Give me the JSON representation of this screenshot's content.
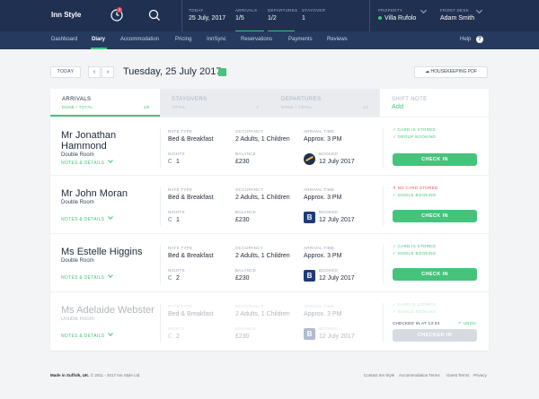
{
  "app": {
    "logo": "Inn Style",
    "notification_count": "3"
  },
  "header": {
    "stats": [
      {
        "label": "TODAY",
        "value": "25 July, 2017"
      },
      {
        "label": "ARRIVALS",
        "value": "1/5"
      },
      {
        "label": "DEPARTURES",
        "value": "1/2"
      },
      {
        "label": "STAYOVER",
        "value": "1"
      }
    ],
    "property_label": "PROPERTY",
    "property_value": "Villa Rufolo",
    "desk_label": "FRONT DESK",
    "desk_value": "Adam Smith"
  },
  "nav": {
    "items": [
      "Dashboard",
      "Diary",
      "Accommodation",
      "Pricing",
      "InnSync",
      "Reservations",
      "Payments",
      "Reviews"
    ],
    "active": "Diary",
    "help": "Help"
  },
  "datebar": {
    "today": "TODAY",
    "prev": "‹",
    "next": "›",
    "date": "Tuesday, 25 July 2017",
    "housekeeping": "HOUSEKEEPING PDF"
  },
  "tabs": [
    {
      "title": "ARRIVALS",
      "sub": "DONE / TOTAL",
      "count": "1/5"
    },
    {
      "title": "STAYOVERS",
      "sub": "TOTAL",
      "count": "1"
    },
    {
      "title": "DEPARTURES",
      "sub": "DONE / TOTAL",
      "count": "1/2"
    },
    {
      "title": "SHIFT NOTE",
      "sub": "Add",
      "count": ""
    }
  ],
  "field_labels": {
    "rate": "RATE TYPE",
    "occupancy": "OCCUPANCY",
    "arrival": "ARRIVAL TIME",
    "nights": "NIGHTS",
    "balance": "BALANCE",
    "booked": "BOOKED",
    "notes": "NOTES & DETAILS"
  },
  "rows": [
    {
      "name": "Mr Jonathan Hammond",
      "room": "Double Room",
      "rate": "Bed & Breakfast",
      "occupancy": "2 Adults, 1 Children",
      "arrival": "Approx. 3 PM",
      "nights": "1",
      "balance": "£230",
      "booked": "12 July 2017",
      "tags": [
        {
          "text": "✓ CARD IS STORED",
          "ok": true
        },
        {
          "text": "✓ GROUP BOOKING",
          "ok": true
        }
      ],
      "button": "CHECK IN"
    },
    {
      "name": "Mr John Moran",
      "room": "Double Room",
      "rate": "Bed & Breakfast",
      "occupancy": "2 Adults, 1 Children",
      "arrival": "Approx. 3 PM",
      "nights": "1",
      "balance": "£230",
      "booked": "12 July 2017",
      "tags": [
        {
          "text": "✕ NO CARD STORED",
          "ok": false
        },
        {
          "text": "✓ SINGLE BOOKING",
          "ok": true
        }
      ],
      "button": "CHECK IN"
    },
    {
      "name": "Ms Estelle Higgins",
      "room": "Double Room",
      "rate": "Bed & Breakfast",
      "occupancy": "2 Adults, 1 Children",
      "arrival": "Approx. 3 PM",
      "nights": "2",
      "balance": "£230",
      "booked": "12 July 2017",
      "tags": [
        {
          "text": "✓ CARD IS STORED",
          "ok": true
        },
        {
          "text": "✓ SINGLE BOOKING",
          "ok": true
        }
      ],
      "button": "CHECK IN"
    },
    {
      "name": "Ms Adelaide Webster",
      "room": "Double Room",
      "rate": "Bed & Breakfast",
      "occupancy": "2 Adults, 1 Children",
      "arrival": "Approx. 3 PM",
      "nights": "2",
      "balance": "£230",
      "booked": "12 July 2017",
      "tags": [
        {
          "text": "✓ CARD IS STORED",
          "ok": true
        },
        {
          "text": "✓ SINGLE BOOKING",
          "ok": true
        }
      ],
      "checked_in": "CHECKED IN AT 13:34",
      "undo": "↶ UNDO",
      "button": "CHECKED IN"
    }
  ],
  "footer": {
    "made_in": "Made in Suffolk, UK.",
    "copyright": "© 2011 - 2017 Inn Style Ltd",
    "links": [
      "Contact Inn Style",
      "Accommodation Terms",
      "Guest Terms",
      "Privacy"
    ]
  },
  "colors": {
    "navy": "#1f3050",
    "nav": "#253a5e",
    "accent": "#46c37b",
    "danger": "#e94b5a"
  }
}
